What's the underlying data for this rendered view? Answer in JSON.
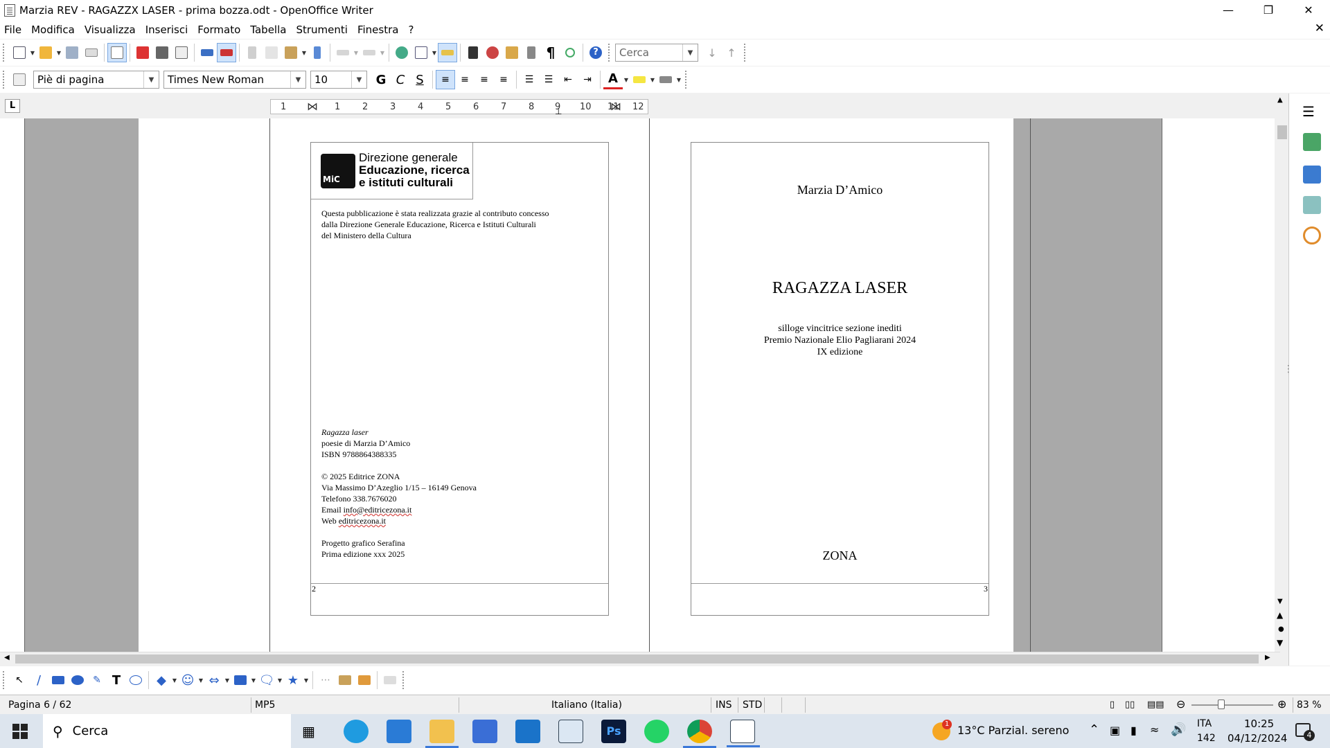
{
  "window": {
    "title": "Marzia REV - RAGAZZX LASER - prima bozza.odt - OpenOffice Writer"
  },
  "menu": [
    {
      "label": "File"
    },
    {
      "label": "Modifica"
    },
    {
      "label": "Visualizza"
    },
    {
      "label": "Inserisci"
    },
    {
      "label": "Formato"
    },
    {
      "label": "Tabella"
    },
    {
      "label": "Strumenti"
    },
    {
      "label": "Finestra"
    },
    {
      "label": "?"
    }
  ],
  "toolbar": {
    "find_value": "Cerca"
  },
  "formatting": {
    "style": "Piè di pagina",
    "font": "Times New Roman",
    "size": "10"
  },
  "ruler": {
    "ticks": [
      "1",
      "1",
      "2",
      "3",
      "4",
      "5",
      "6",
      "7",
      "8",
      "9",
      "10",
      "11",
      "12"
    ]
  },
  "page_left": {
    "logo_line1": "Direzione generale",
    "logo_line2": "Educazione, ricerca",
    "logo_line3": "e istituti culturali",
    "logo_mark": "MiC",
    "credit_lines": [
      "Questa pubblicazione è stata realizzata grazie al contributo concesso",
      "dalla Direzione Generale Educazione, Ricerca e Istituti Culturali",
      "del Ministero della Cultura"
    ],
    "book_title": "Ragazza laser",
    "book_lines": [
      "poesie di Marzia D’Amico",
      "ISBN 9788864388335"
    ],
    "publisher_lines": [
      "© 2025 Editrice ZONA",
      "Via Massimo D’Azeglio 1/15 – 16149 Genova",
      "Telefono 338.7676020"
    ],
    "email_label": "Email ",
    "email": "info@editricezona.it",
    "web_label": "Web ",
    "web": "editricezona.it",
    "design_lines": [
      "Progetto grafico Serafina",
      "Prima edizione xxx 2025"
    ],
    "page_number": "2"
  },
  "page_right": {
    "author": "Marzia D’Amico",
    "title": "RAGAZZA LASER",
    "subtitle_lines": [
      "silloge vincitrice sezione inediti",
      "Premio Nazionale Elio Pagliarani 2024",
      "IX edizione"
    ],
    "publisher": "ZONA",
    "page_number": "3"
  },
  "status": {
    "page": "Pagina 6 / 62",
    "page_style": "MP5",
    "language": "Italiano (Italia)",
    "ins": "INS",
    "std": "STD",
    "zoom": "83 %"
  },
  "taskbar": {
    "search": "Cerca",
    "weather": "13°C  Parzial. sereno",
    "weather_badge": "1",
    "lang": "ITA",
    "lang_sub": "142",
    "time": "10:25",
    "date": "04/12/2024",
    "notif": "4"
  },
  "colors": {
    "accent": "#3b78d8",
    "gray_bg": "#a9a9a9",
    "spell_underline": "#d9534f"
  }
}
